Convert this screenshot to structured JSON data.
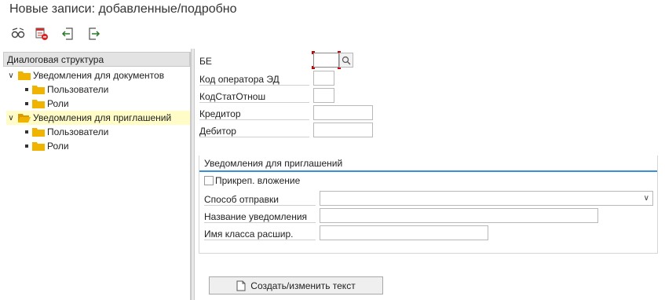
{
  "window": {
    "title": "Новые записи: добавленные/подробно"
  },
  "toolbar": {
    "buttons": [
      {
        "icon": "display-change-icon"
      },
      {
        "icon": "delete-icon"
      },
      {
        "icon": "previous-entry-icon"
      },
      {
        "icon": "next-entry-icon"
      }
    ]
  },
  "tree": {
    "header": "Диалоговая структура",
    "nodes": [
      {
        "label": "Уведомления для документов",
        "expanded": true,
        "selected": false
      },
      {
        "label": "Пользователи"
      },
      {
        "label": "Роли"
      },
      {
        "label": "Уведомления для приглашений",
        "expanded": true,
        "selected": true
      },
      {
        "label": "Пользователи"
      },
      {
        "label": "Роли"
      }
    ]
  },
  "form": {
    "fields": [
      {
        "label": "БЕ",
        "value": ""
      },
      {
        "label": "Код оператора ЭД",
        "value": ""
      },
      {
        "label": "КодСтатОтнош",
        "value": ""
      },
      {
        "label": "Кредитор",
        "value": ""
      },
      {
        "label": "Дебитор",
        "value": ""
      }
    ]
  },
  "group": {
    "title": "Уведомления для приглашений",
    "checkbox_label": "Прикреп. вложение",
    "checkbox_checked": false,
    "fields": [
      {
        "label": "Способ отправки",
        "value": ""
      },
      {
        "label": "Название уведомления",
        "value": ""
      },
      {
        "label": "Имя класса расшир.",
        "value": ""
      }
    ]
  },
  "actions": {
    "create_text_label": "Создать/изменить текст"
  },
  "colors": {
    "accent_line": "#3b8fd6",
    "selected_row": "#fffcc8",
    "folder": "#f0b400",
    "focus": "#cc0000"
  }
}
